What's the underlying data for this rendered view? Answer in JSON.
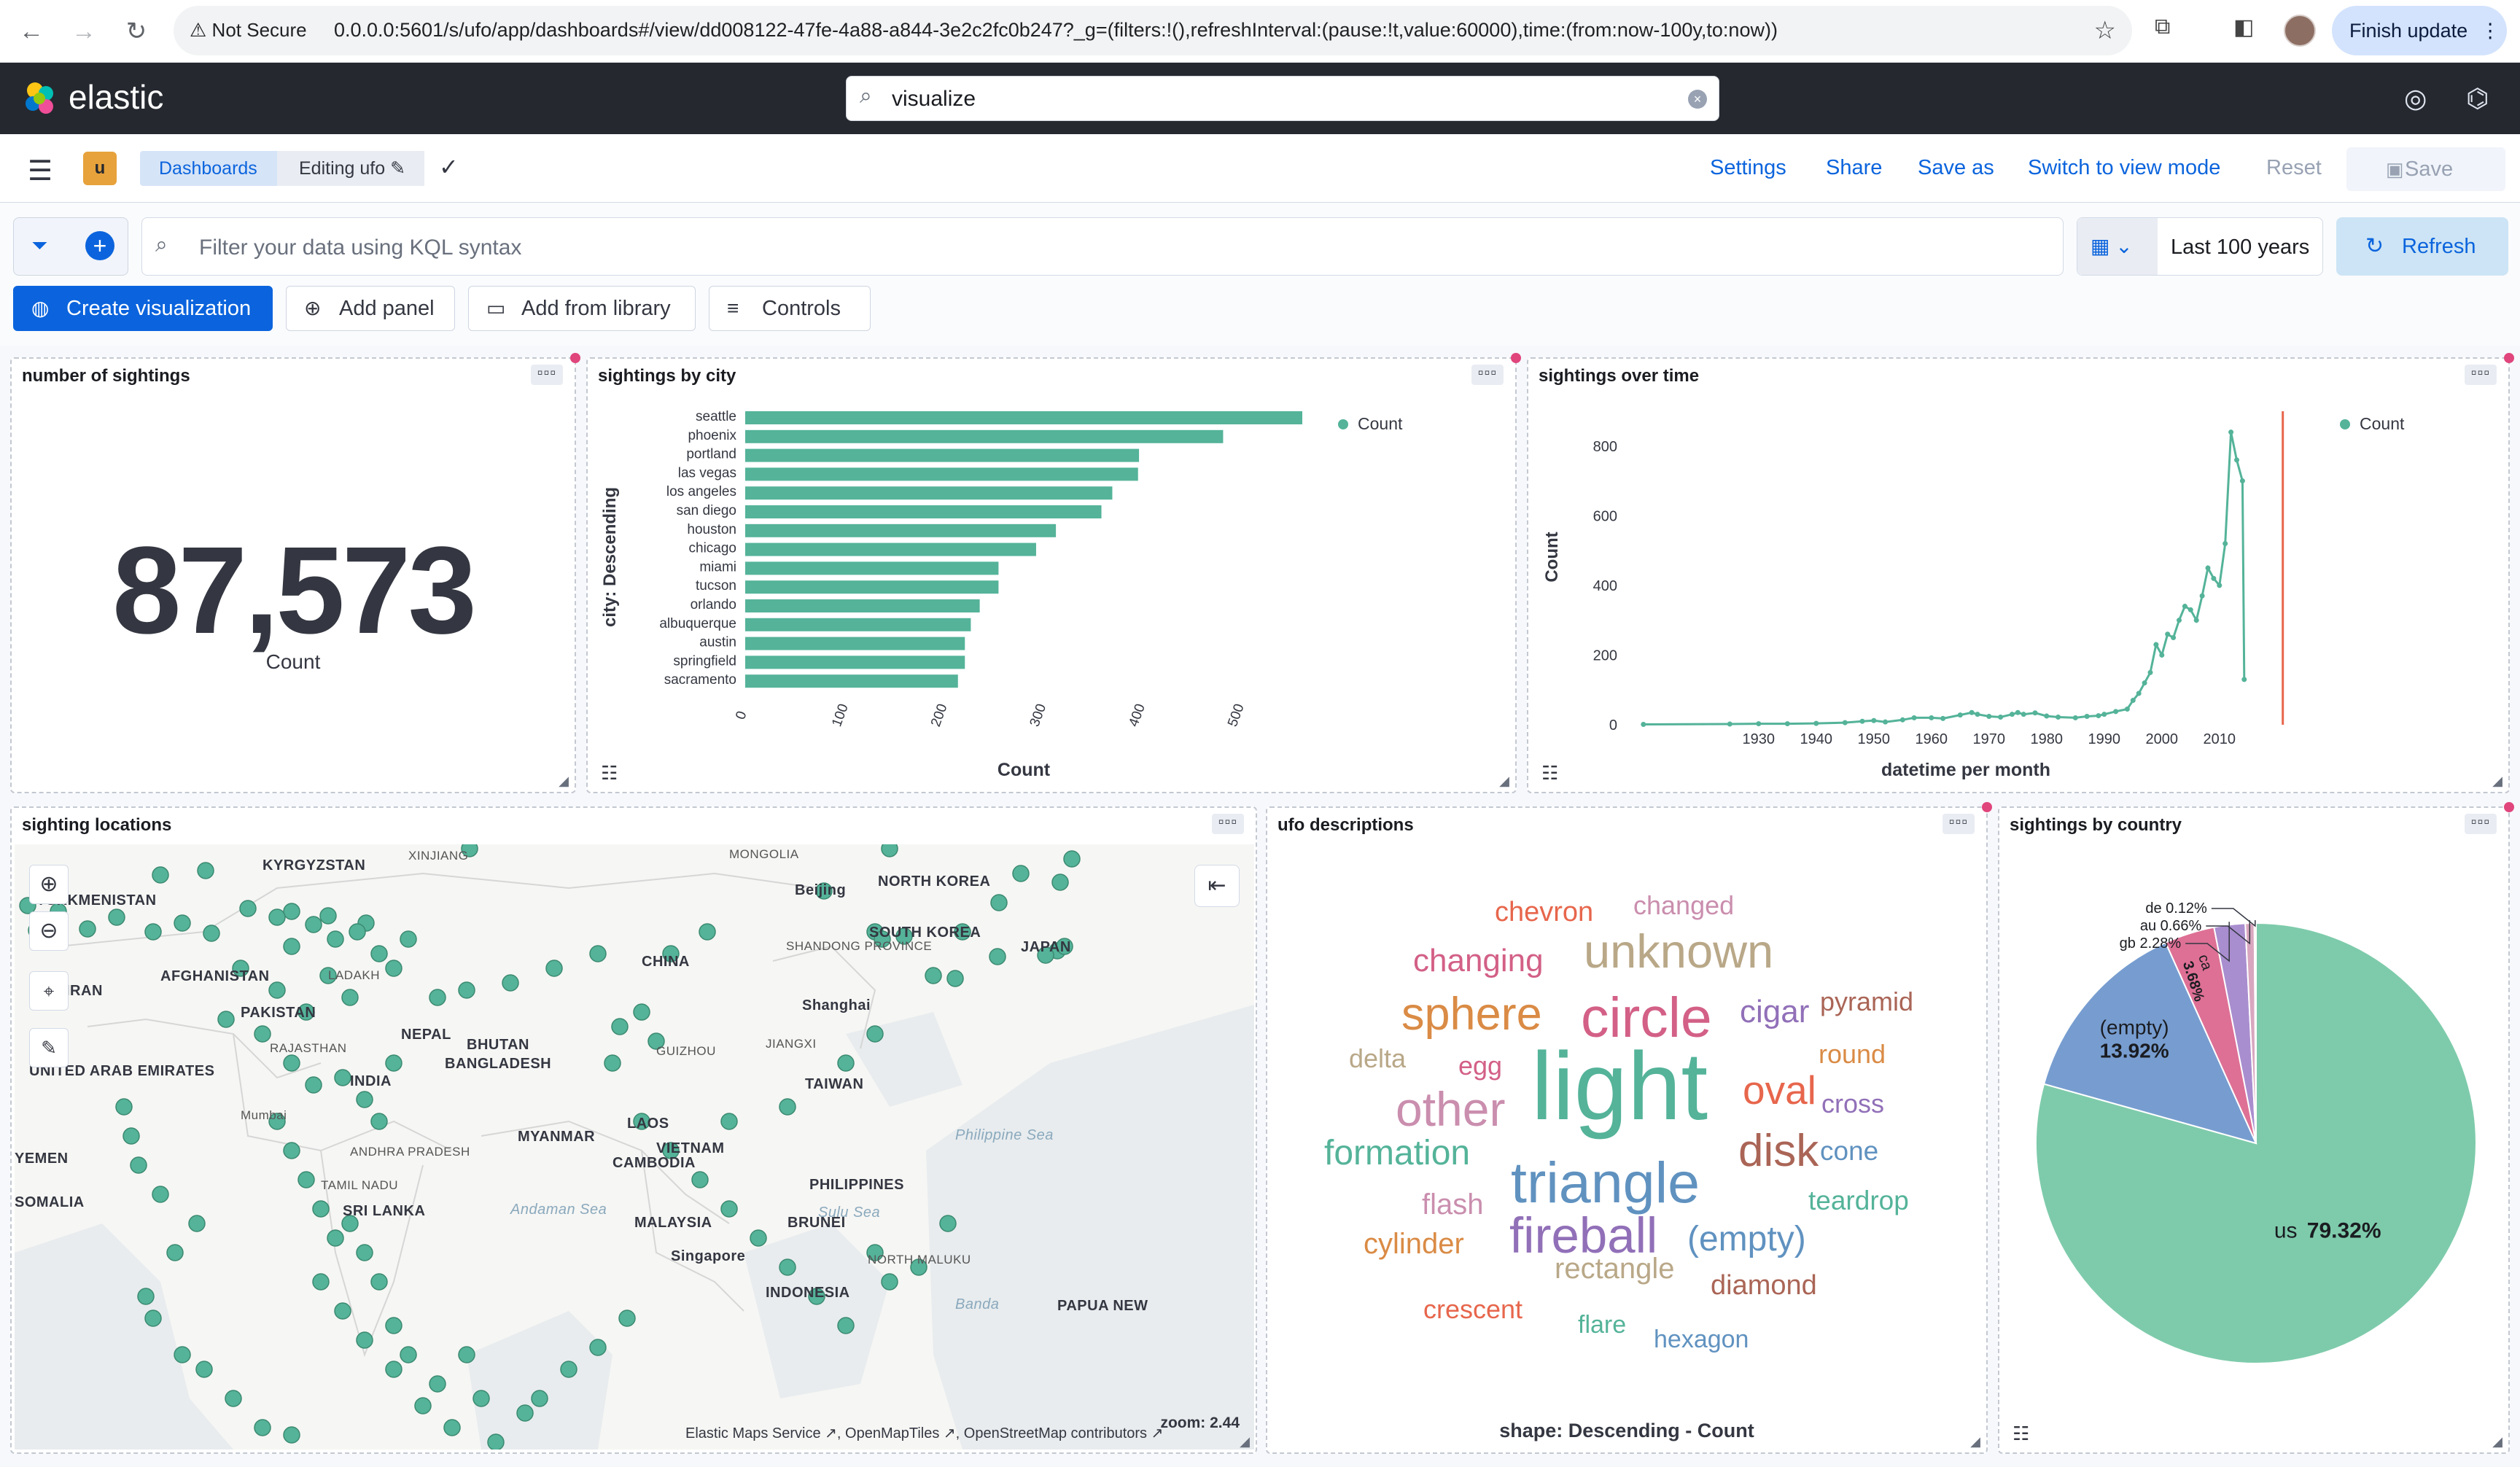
{
  "browser": {
    "security_label": "Not Secure",
    "url": "0.0.0.0:5601/s/ufo/app/dashboards#/view/dd008122-47fe-4a88-a844-3e2c2fc0b247?_g=(filters:!(),refreshInterval:(pause:!t,value:60000),time:(from:now-100y,to:now))",
    "finish_update": "Finish update"
  },
  "header": {
    "brand": "elastic",
    "search_value": "visualize"
  },
  "appbar": {
    "space_badge": "u",
    "breadcrumbs": [
      "Dashboards",
      "Editing ufo"
    ],
    "actions": {
      "settings": "Settings",
      "share": "Share",
      "save_as": "Save as",
      "view_mode": "Switch to view mode",
      "reset": "Reset",
      "save": "Save"
    }
  },
  "querybar": {
    "placeholder": "Filter your data using KQL syntax",
    "time_range": "Last 100 years",
    "refresh": "Refresh"
  },
  "toolbar": {
    "create_viz": "Create visualization",
    "add_panel": "Add panel",
    "add_library": "Add from library",
    "controls": "Controls"
  },
  "panels": {
    "metric": {
      "title": "number of sightings",
      "value": "87,573",
      "label": "Count"
    },
    "city": {
      "title": "sightings by city"
    },
    "time": {
      "title": "sightings over time"
    },
    "map": {
      "title": "sighting locations",
      "zoom": "zoom: 2.44",
      "attribution": "Elastic Maps Service ↗, OpenMapTiles ↗, OpenStreetMap contributors ↗",
      "labels": [
        "KYRGYZSTAN",
        "XINJIANG",
        "MONGOLIA",
        "TURKMENISTAN",
        "NORTH KOREA",
        "Beijing",
        "SOUTH KOREA",
        "JAPAN",
        "AFGHANISTAN",
        "CHINA",
        "SHANDONG PROVINCE",
        "IRAN",
        "LADAKH",
        "PAKISTAN",
        "Shanghai",
        "NEPAL",
        "RAJASTHAN",
        "BHUTAN",
        "GUIZHOU",
        "JIANGXI",
        "UNITED ARAB EMIRATES",
        "BANGLADESH",
        "TAIWAN",
        "INDIA",
        "Mumbai",
        "LAOS",
        "MYANMAR",
        "VIETNAM",
        "ANDHRA PRADESH",
        "YEMEN",
        "TAMIL NADU",
        "CAMBODIA",
        "PHILIPPINES",
        "Andaman Sea",
        "Sulu Sea",
        "SRI LANKA",
        "SOMALIA",
        "Philippine Sea",
        "MALAYSIA",
        "BRUNEI",
        "Singapore",
        "NORTH MALUKU",
        "INDONESIA",
        "Banda",
        "PAPUA NEW"
      ]
    },
    "words": {
      "title": "ufo descriptions",
      "footer": "shape: Descending - Count"
    },
    "country": {
      "title": "sightings by country"
    }
  },
  "chart_data": [
    {
      "type": "bar",
      "orientation": "horizontal",
      "categories": [
        "seattle",
        "phoenix",
        "portland",
        "las vegas",
        "los angeles",
        "san diego",
        "houston",
        "chicago",
        "miami",
        "tucson",
        "orlando",
        "albuquerque",
        "austin",
        "springfield",
        "sacramento"
      ],
      "series": [
        {
          "name": "Count",
          "values": [
            563,
            483,
            398,
            397,
            371,
            360,
            314,
            294,
            256,
            256,
            237,
            228,
            222,
            222,
            215
          ]
        }
      ],
      "xlabel": "Count",
      "ylabel": "city: Descending",
      "xticks": [
        0,
        100,
        200,
        300,
        400,
        500
      ],
      "xlim": [
        0,
        563
      ],
      "legend": "top-right",
      "color": "#54b399"
    },
    {
      "type": "line",
      "series": [
        {
          "name": "Count",
          "points": [
            [
              1910,
              1
            ],
            [
              1925,
              2
            ],
            [
              1930,
              3
            ],
            [
              1935,
              3
            ],
            [
              1940,
              4
            ],
            [
              1945,
              6
            ],
            [
              1948,
              10
            ],
            [
              1950,
              12
            ],
            [
              1952,
              8
            ],
            [
              1955,
              14
            ],
            [
              1957,
              20
            ],
            [
              1960,
              20
            ],
            [
              1962,
              18
            ],
            [
              1965,
              28
            ],
            [
              1967,
              35
            ],
            [
              1968,
              30
            ],
            [
              1970,
              24
            ],
            [
              1972,
              22
            ],
            [
              1974,
              30
            ],
            [
              1975,
              35
            ],
            [
              1976,
              30
            ],
            [
              1978,
              34
            ],
            [
              1980,
              25
            ],
            [
              1982,
              22
            ],
            [
              1985,
              20
            ],
            [
              1987,
              24
            ],
            [
              1989,
              26
            ],
            [
              1990,
              30
            ],
            [
              1992,
              38
            ],
            [
              1994,
              45
            ],
            [
              1995,
              70
            ],
            [
              1996,
              90
            ],
            [
              1997,
              120
            ],
            [
              1998,
              150
            ],
            [
              1999,
              230
            ],
            [
              2000,
              200
            ],
            [
              2001,
              260
            ],
            [
              2002,
              250
            ],
            [
              2003,
              300
            ],
            [
              2004,
              340
            ],
            [
              2005,
              330
            ],
            [
              2006,
              300
            ],
            [
              2007,
              370
            ],
            [
              2008,
              450
            ],
            [
              2009,
              420
            ],
            [
              2010,
              400
            ],
            [
              2011,
              520
            ],
            [
              2012,
              840
            ],
            [
              2013,
              760
            ],
            [
              2014,
              700
            ],
            [
              2014.3,
              130
            ]
          ]
        }
      ],
      "xlabel": "datetime per month",
      "ylabel": "Count",
      "xticks": [
        1930,
        1940,
        1950,
        1960,
        1970,
        1980,
        1990,
        2000,
        2010
      ],
      "yticks": [
        0,
        200,
        400,
        600,
        800
      ],
      "ylim": [
        0,
        900
      ],
      "xlim": [
        1908,
        2028
      ],
      "current_time_marker": 2021,
      "legend": "top-right",
      "color": "#54b399"
    },
    {
      "type": "wordcloud",
      "words": [
        {
          "text": "light",
          "weight": 100,
          "color": "#54b399"
        },
        {
          "text": "triangle",
          "weight": 60,
          "color": "#6092c0"
        },
        {
          "text": "circle",
          "weight": 58,
          "color": "#d36086"
        },
        {
          "text": "fireball",
          "weight": 52,
          "color": "#9170b8"
        },
        {
          "text": "other",
          "weight": 50,
          "color": "#ca8eae"
        },
        {
          "text": "unknown",
          "weight": 49,
          "color": "#b9a888"
        },
        {
          "text": "sphere",
          "weight": 48,
          "color": "#da8b45"
        },
        {
          "text": "disk",
          "weight": 47,
          "color": "#aa6556"
        },
        {
          "text": "oval",
          "weight": 42,
          "color": "#e7664c"
        },
        {
          "text": "formation",
          "weight": 36,
          "color": "#54b399"
        },
        {
          "text": "(empty)",
          "weight": 36,
          "color": "#6092c0"
        },
        {
          "text": "changing",
          "weight": 33,
          "color": "#d36086"
        },
        {
          "text": "cigar",
          "weight": 33,
          "color": "#9170b8"
        },
        {
          "text": "flash",
          "weight": 30,
          "color": "#ca8eae"
        },
        {
          "text": "rectangle",
          "weight": 30,
          "color": "#b9a888"
        },
        {
          "text": "cylinder",
          "weight": 30,
          "color": "#da8b45"
        },
        {
          "text": "diamond",
          "weight": 29,
          "color": "#aa6556"
        },
        {
          "text": "chevron",
          "weight": 29,
          "color": "#e7664c"
        },
        {
          "text": "teardrop",
          "weight": 28,
          "color": "#54b399"
        },
        {
          "text": "cone",
          "weight": 28,
          "color": "#6092c0"
        },
        {
          "text": "egg",
          "weight": 27,
          "color": "#d36086"
        },
        {
          "text": "cross",
          "weight": 27,
          "color": "#9170b8"
        },
        {
          "text": "changed",
          "weight": 27,
          "color": "#ca8eae"
        },
        {
          "text": "delta",
          "weight": 27,
          "color": "#b9a888"
        },
        {
          "text": "round",
          "weight": 27,
          "color": "#da8b45"
        },
        {
          "text": "pyramid",
          "weight": 27,
          "color": "#aa6556"
        },
        {
          "text": "crescent",
          "weight": 27,
          "color": "#e7664c"
        },
        {
          "text": "flare",
          "weight": 26,
          "color": "#54b399"
        },
        {
          "text": "hexagon",
          "weight": 26,
          "color": "#6092c0"
        }
      ]
    },
    {
      "type": "pie",
      "slices": [
        {
          "label": "us",
          "value": 79.32,
          "display": "79.32%",
          "color": "#7ecbab"
        },
        {
          "label": "(empty)",
          "value": 13.92,
          "display": "13.92%",
          "color": "#779dd0"
        },
        {
          "label": "ca",
          "value": 3.68,
          "display": "3.68%",
          "color": "#de7095"
        },
        {
          "label": "gb",
          "value": 2.28,
          "display": "2.28%",
          "color": "#a98ecf"
        },
        {
          "label": "au",
          "value": 0.66,
          "display": "0.66%",
          "color": "#d8a7bf"
        },
        {
          "label": "de",
          "value": 0.12,
          "display": "0.12%",
          "color": "#cdb89c"
        }
      ]
    }
  ]
}
